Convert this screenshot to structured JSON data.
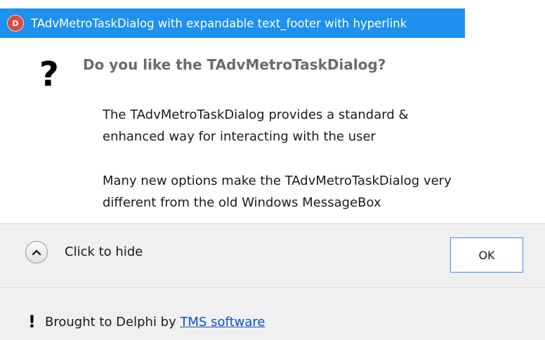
{
  "window": {
    "title": "TAdvMetroTaskDialog with expandable text_footer with hyperlink",
    "title_color": "#1e90ee",
    "app_icon": "delphi-app-icon"
  },
  "dialog": {
    "main_icon": "question-icon",
    "main_icon_glyph": "?",
    "main_instruction": "Do you like the TAdvMetroTaskDialog?",
    "content_lines": [
      "The TAdvMetroTaskDialog provides a standard &",
      "enhanced way for interacting with the user",
      "Many new options make the TAdvMetroTaskDialog very",
      "different from the old Windows MessageBox"
    ]
  },
  "buttons": {
    "expand_icon": "chevron-up-icon",
    "expand_label": "Click to hide",
    "ok_label": "OK",
    "ok_border_color": "#3d8ee0"
  },
  "footer": {
    "icon": "exclamation-icon",
    "icon_glyph": "!",
    "text": "Brought to Delphi by ",
    "link_text": "TMS software",
    "link_color": "#0a50d0"
  }
}
